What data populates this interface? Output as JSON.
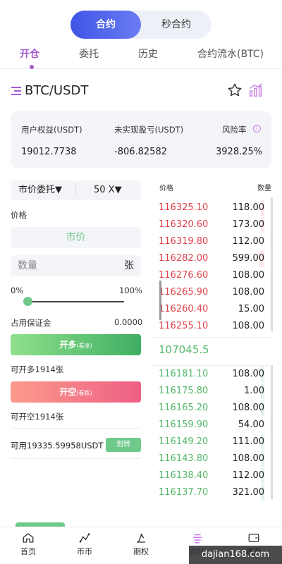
{
  "mode_switch": {
    "options": [
      "合约",
      "秒合约"
    ],
    "active": "合约"
  },
  "tabs": [
    "开仓",
    "委托",
    "历史",
    "合约流水(BTC)"
  ],
  "active_tab": "开仓",
  "pair": "BTC/USDT",
  "account": {
    "equity_label": "用户权益(USDT)",
    "equity": "19012.7738",
    "pnl_label": "未实现盈亏(USDT)",
    "pnl": "-806.82582",
    "risk_label": "风险率",
    "risk": "3928.25%"
  },
  "order_form": {
    "order_type": "市价委托",
    "leverage": "50 X",
    "price_label": "价格",
    "price_value": "市价",
    "qty_placeholder": "数量",
    "qty_unit": "张",
    "slider_min": "0%",
    "slider_max": "100%",
    "slider_value": 0,
    "margin_label": "占用保证金",
    "margin_value": "0.0000",
    "buy_label": "开多",
    "buy_sub": "(看涨)",
    "buy_avail": "可开多1914张",
    "sell_label": "开空",
    "sell_sub": "(看跌)",
    "sell_avail": "可开空1914张",
    "available": "可用19335.59958USDT",
    "transfer_label": "划转"
  },
  "orderbook": {
    "price_header": "价格",
    "qty_header": "数量",
    "asks": [
      {
        "price": "116325.10",
        "qty": "118.00",
        "depth": 0.03
      },
      {
        "price": "116320.60",
        "qty": "173.00",
        "depth": 0.03
      },
      {
        "price": "116319.80",
        "qty": "112.00",
        "depth": 0.0
      },
      {
        "price": "116282.00",
        "qty": "599.00",
        "depth": 0.05
      },
      {
        "price": "116276.60",
        "qty": "108.00",
        "depth": 0.0
      },
      {
        "price": "116265.90",
        "qty": "108.00",
        "depth": 0.0
      },
      {
        "price": "116260.40",
        "qty": "15.00",
        "depth": 0.0
      },
      {
        "price": "116255.10",
        "qty": "108.00",
        "depth": 0.0
      }
    ],
    "last_price": "107045.5",
    "bids": [
      {
        "price": "116181.10",
        "qty": "108.00",
        "depth": 0.03
      },
      {
        "price": "116175.80",
        "qty": "1.00",
        "depth": 0.03
      },
      {
        "price": "116165.20",
        "qty": "108.00",
        "depth": 0.03
      },
      {
        "price": "116159.90",
        "qty": "54.00",
        "depth": 0.0
      },
      {
        "price": "116149.20",
        "qty": "111.00",
        "depth": 0.03
      },
      {
        "price": "116143.80",
        "qty": "108.00",
        "depth": 0.03
      },
      {
        "price": "116138.40",
        "qty": "112.00",
        "depth": 0.03
      },
      {
        "price": "116137.70",
        "qty": "321.00",
        "depth": 0.03
      }
    ]
  },
  "bottom_nav": [
    {
      "label": "首页",
      "icon": "home-icon"
    },
    {
      "label": "币币",
      "icon": "trend-icon"
    },
    {
      "label": "期权",
      "icon": "options-icon"
    },
    {
      "label": "合约",
      "icon": "contract-icon"
    },
    {
      "label": "资产",
      "icon": "wallet-icon"
    }
  ],
  "watermark": "dajian168.com",
  "colors": {
    "accent": "#a35ccf",
    "buy": "#55b86a",
    "sell": "#e0424a",
    "primary": "#3f55e6"
  }
}
